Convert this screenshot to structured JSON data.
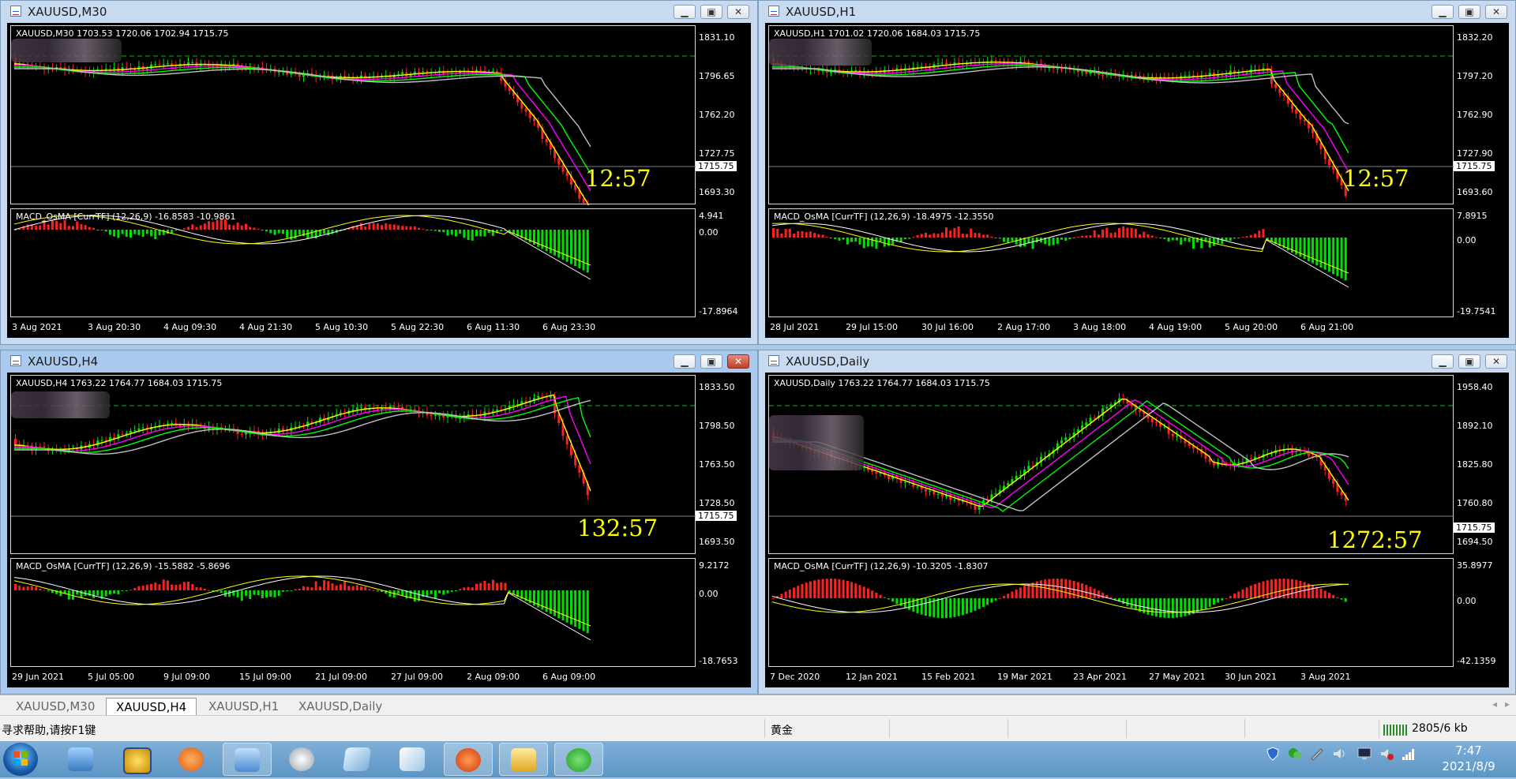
{
  "windows": [
    {
      "id": "m30",
      "title": "XAUUSD,M30",
      "active": false,
      "price_label": "XAUUSD,M30  1703.53 1720.06 1702.94 1715.75",
      "price_axis": [
        "1831.10",
        "1796.65",
        "1762.20",
        "1727.75",
        "1693.30"
      ],
      "current_price": "1715.75",
      "timer": "12:57",
      "osc_label": "MACD_OsMA [CurrTF] (12,26,9) -16.8583 -10.9861",
      "osc_axis": [
        "4.941",
        "0.00",
        "-17.8964"
      ],
      "x_axis": [
        "3 Aug 2021",
        "3 Aug 20:30",
        "4 Aug 09:30",
        "4 Aug 21:30",
        "5 Aug 10:30",
        "5 Aug 22:30",
        "6 Aug 11:30",
        "6 Aug 23:30"
      ]
    },
    {
      "id": "h1",
      "title": "XAUUSD,H1",
      "active": false,
      "price_label": "XAUUSD,H1  1701.02 1720.06 1684.03 1715.75",
      "price_axis": [
        "1832.20",
        "1797.20",
        "1762.90",
        "1727.90",
        "1693.60"
      ],
      "current_price": "1715.75",
      "timer": "12:57",
      "osc_label": "MACD_OsMA [CurrTF] (12,26,9) -18.4975 -12.3550",
      "osc_axis": [
        "7.8915",
        "0.00",
        "-19.7541"
      ],
      "x_axis": [
        "28 Jul 2021",
        "29 Jul 15:00",
        "30 Jul 16:00",
        "2 Aug 17:00",
        "3 Aug 18:00",
        "4 Aug 19:00",
        "5 Aug 20:00",
        "6 Aug 21:00"
      ]
    },
    {
      "id": "h4",
      "title": "XAUUSD,H4",
      "active": true,
      "price_label": "XAUUSD,H4  1763.22 1764.77 1684.03 1715.75",
      "price_axis": [
        "1833.50",
        "1798.50",
        "1763.50",
        "1728.50",
        "1693.50"
      ],
      "current_price": "1715.75",
      "timer": "132:57",
      "osc_label": "MACD_OsMA [CurrTF] (12,26,9) -15.5882 -5.8696",
      "osc_axis": [
        "9.2172",
        "0.00",
        "-18.7653"
      ],
      "x_axis": [
        "29 Jun 2021",
        "5 Jul 05:00",
        "9 Jul 09:00",
        "15 Jul 09:00",
        "21 Jul 09:00",
        "27 Jul 09:00",
        "2 Aug 09:00",
        "6 Aug 09:00"
      ]
    },
    {
      "id": "d1",
      "title": "XAUUSD,Daily",
      "active": false,
      "price_label": "XAUUSD,Daily  1763.22 1764.77 1684.03 1715.75",
      "price_axis": [
        "1958.40",
        "1892.10",
        "1825.80",
        "1760.80",
        "1694.50"
      ],
      "current_price": "1715.75",
      "timer": "1272:57",
      "osc_label": "MACD_OsMA [CurrTF] (12,26,9) -10.3205 -1.8307",
      "osc_axis": [
        "35.8977",
        "0.00",
        "-42.1359"
      ],
      "x_axis": [
        "7 Dec 2020",
        "12 Jan 2021",
        "15 Feb 2021",
        "19 Mar 2021",
        "23 Apr 2021",
        "27 May 2021",
        "30 Jun 2021",
        "3 Aug 2021"
      ]
    }
  ],
  "tabs": [
    "XAUUSD,M30",
    "XAUUSD,H4",
    "XAUUSD,H1",
    "XAUUSD,Daily"
  ],
  "selected_tab": "XAUUSD,H4",
  "status": {
    "help": "寻求帮助,请按F1键",
    "symbol": "黄金",
    "traffic": "2805/6 kb"
  },
  "clock": {
    "time": "7:47",
    "date": "2021/8/9"
  },
  "colors": {
    "bull": "#00e000",
    "bear": "#ff2020",
    "timer": "#ffff00",
    "ma1": "#ffff00",
    "ma2": "#ff00ff",
    "ma3": "#00ff00",
    "ma4": "#c0c0c0"
  }
}
